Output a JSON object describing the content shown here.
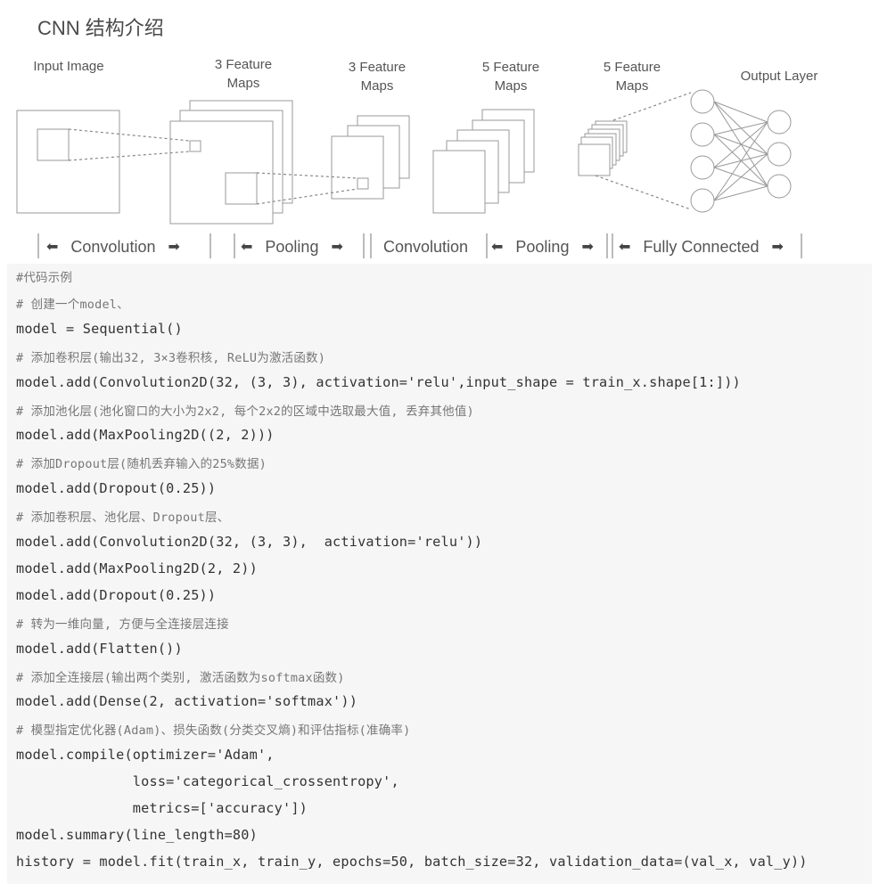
{
  "title": "CNN 结构介绍",
  "diagram": {
    "labels": {
      "input": "Input  Image",
      "fm1_a": "3 Feature",
      "fm1_b": "Maps",
      "fm2_a": "3 Feature",
      "fm2_b": "Maps",
      "fm3_a": "5 Feature",
      "fm3_b": "Maps",
      "fm4_a": "5 Feature",
      "fm4_b": "Maps",
      "output": "Output Layer"
    },
    "stages": [
      "Convolution",
      "Pooling",
      "Convolution",
      "Pooling",
      "Fully Connected"
    ],
    "arrow_left": "⬅",
    "arrow_right": "➡",
    "network": {
      "hidden_nodes": 4,
      "output_nodes": 3
    }
  },
  "code": {
    "lines": [
      {
        "text": "#代码示例",
        "type": "comment"
      },
      {
        "text": "# 创建一个model、",
        "type": "comment"
      },
      {
        "text": "model = Sequential()",
        "type": "code"
      },
      {
        "text": "# 添加卷积层(输出32, 3×3卷积核, ReLU为激活函数)",
        "type": "comment"
      },
      {
        "text": "model.add(Convolution2D(32, (3, 3), activation='relu',input_shape = train_x.shape[1:]))",
        "type": "code"
      },
      {
        "text": "# 添加池化层(池化窗口的大小为2x2, 每个2x2的区域中选取最大值, 丢弃其他值)",
        "type": "comment"
      },
      {
        "text": "model.add(MaxPooling2D((2, 2)))",
        "type": "code"
      },
      {
        "text": "# 添加Dropout层(随机丢弃输入的25%数据)",
        "type": "comment"
      },
      {
        "text": "model.add(Dropout(0.25))",
        "type": "code"
      },
      {
        "text": "# 添加卷积层、池化层、Dropout层、",
        "type": "comment"
      },
      {
        "text": "model.add(Convolution2D(32, (3, 3),  activation='relu'))",
        "type": "code"
      },
      {
        "text": "model.add(MaxPooling2D(2, 2))",
        "type": "code"
      },
      {
        "text": "model.add(Dropout(0.25))",
        "type": "code"
      },
      {
        "text": "# 转为一维向量, 方便与全连接层连接",
        "type": "comment"
      },
      {
        "text": "model.add(Flatten())",
        "type": "code"
      },
      {
        "text": "# 添加全连接层(输出两个类别, 激活函数为softmax函数)",
        "type": "comment"
      },
      {
        "text": "model.add(Dense(2, activation='softmax'))",
        "type": "code"
      },
      {
        "text": "# 模型指定优化器(Adam)、损失函数(分类交叉熵)和评估指标(准确率)",
        "type": "comment"
      },
      {
        "text": "model.compile(optimizer='Adam',",
        "type": "code"
      },
      {
        "text": "              loss='categorical_crossentropy',",
        "type": "code"
      },
      {
        "text": "              metrics=['accuracy'])",
        "type": "code"
      },
      {
        "text": "model.summary(line_length=80)",
        "type": "code"
      },
      {
        "text": "history = model.fit(train_x, train_y, epochs=50, batch_size=32, validation_data=(val_x, val_y))",
        "type": "code"
      }
    ]
  }
}
